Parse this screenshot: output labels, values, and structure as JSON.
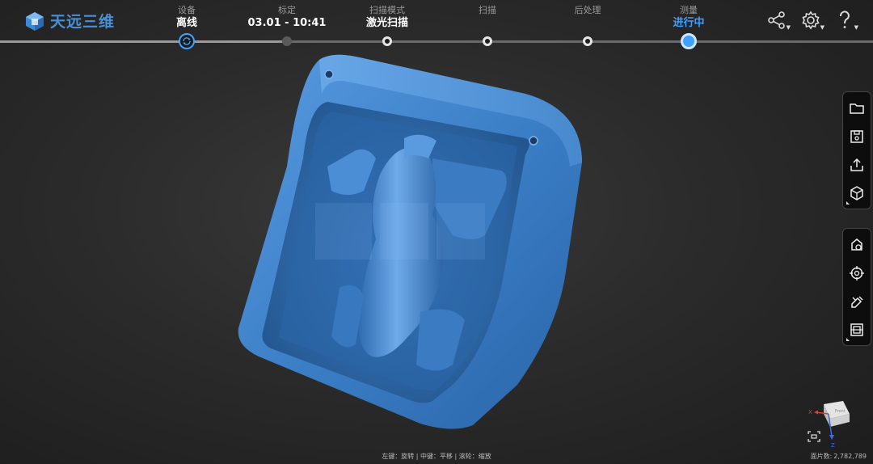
{
  "app": {
    "logo_text": "天远三维",
    "accent": "#3ea0ff",
    "brand": "#4a8fd6"
  },
  "steps": [
    {
      "label": "设备",
      "value": "离线",
      "state": "device"
    },
    {
      "label": "标定",
      "value": "03.01 - 10:41",
      "state": "done"
    },
    {
      "label": "扫描模式",
      "value": "激光扫描",
      "state": "pending"
    },
    {
      "label": "扫描",
      "value": "",
      "state": "pending"
    },
    {
      "label": "后处理",
      "value": "",
      "state": "pending"
    },
    {
      "label": "测量",
      "value": "进行中",
      "state": "active"
    }
  ],
  "top_icons": [
    "share-icon",
    "settings-icon",
    "help-icon"
  ],
  "toolbar_file": [
    "open-folder-icon",
    "save-icon",
    "export-icon",
    "view-cube-icon"
  ],
  "toolbar_tools": [
    "marker-select-icon",
    "target-icon",
    "edit-erase-icon",
    "section-view-icon"
  ],
  "status": {
    "hint": "左键：旋转 | 中键：平移 | 滚轮：缩放",
    "face_label": "面片数:",
    "face_count": "2,782,789"
  },
  "axis": {
    "x_label": "X",
    "z_label": "Z",
    "cube_label": "Front"
  }
}
